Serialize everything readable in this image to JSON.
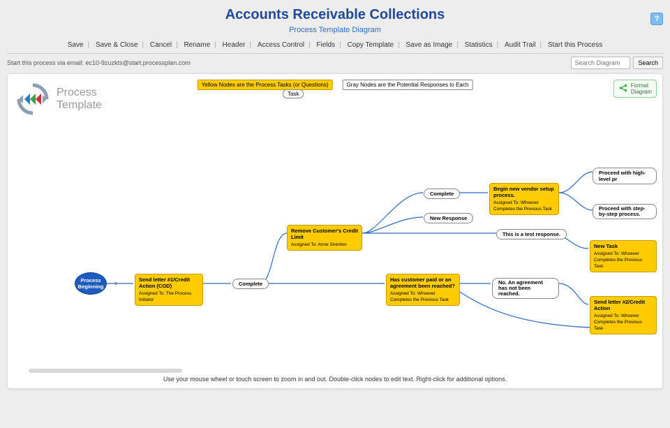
{
  "header": {
    "title": "Accounts Receivable Collections",
    "subtitle": "Process Template Diagram"
  },
  "toolbar": {
    "items": [
      "Save",
      "Save & Close",
      "Cancel",
      "Rename",
      "Header",
      "Access Control",
      "Fields",
      "Copy Template",
      "Save as Image",
      "Statistics",
      "Audit Trail",
      "Start this Process"
    ]
  },
  "subbar": {
    "email_hint": "Start this process via email: ec10-9zuzkts@start.processplan.com",
    "search_placeholder": "Search Diagram",
    "search_button": "Search"
  },
  "help_label": "?",
  "canvas_header": {
    "line1": "Process",
    "line2": "Template"
  },
  "legend": {
    "yellow": "Yellow Nodes are the Process Tasks (or Questions)",
    "task_pill": "Task",
    "gray": "Gray Nodes are the Potential Responses to Each"
  },
  "format_button": {
    "line1": "Format",
    "line2": "Diagram"
  },
  "nodes": {
    "start": "Process Beginning",
    "task1": {
      "title": "Send letter #1/Credit Action (COD)",
      "assigned": "Assigned To: The Process Initiator"
    },
    "resp_complete1": "Complete",
    "task2": {
      "title": "Remove Customer's Credit Limit",
      "assigned": "Assigned To: Anne Shenton"
    },
    "resp_complete2": "Complete",
    "resp_newresp": "New Response",
    "resp_test": "This is a test response.",
    "task3": {
      "title": "Begin new vendor setup process.",
      "assigned": "Assigned To: Whoever Completes the Previous Task"
    },
    "resp_highlevel": "Proceed with high-level pr",
    "resp_stepbystep": "Proceed with step-by-step process.",
    "task_new": {
      "title": "New Task",
      "assigned": "Assigned To: Whoever Completes the Previous Task"
    },
    "task4": {
      "title": "Has customer paid or an agreement been reached?",
      "assigned": "Assigned To: Whoever Completes the Previous Task"
    },
    "resp_no": "No.  An agreement has not been reached.",
    "task5": {
      "title": "Send letter #2/Credit Action",
      "assigned": "Assigned To: Whoever Completes the Previous Task"
    }
  },
  "footer_hint": "Use your mouse wheel or touch screen to zoom in and out.  Double-click nodes to edit text.  Right-click for additional options."
}
